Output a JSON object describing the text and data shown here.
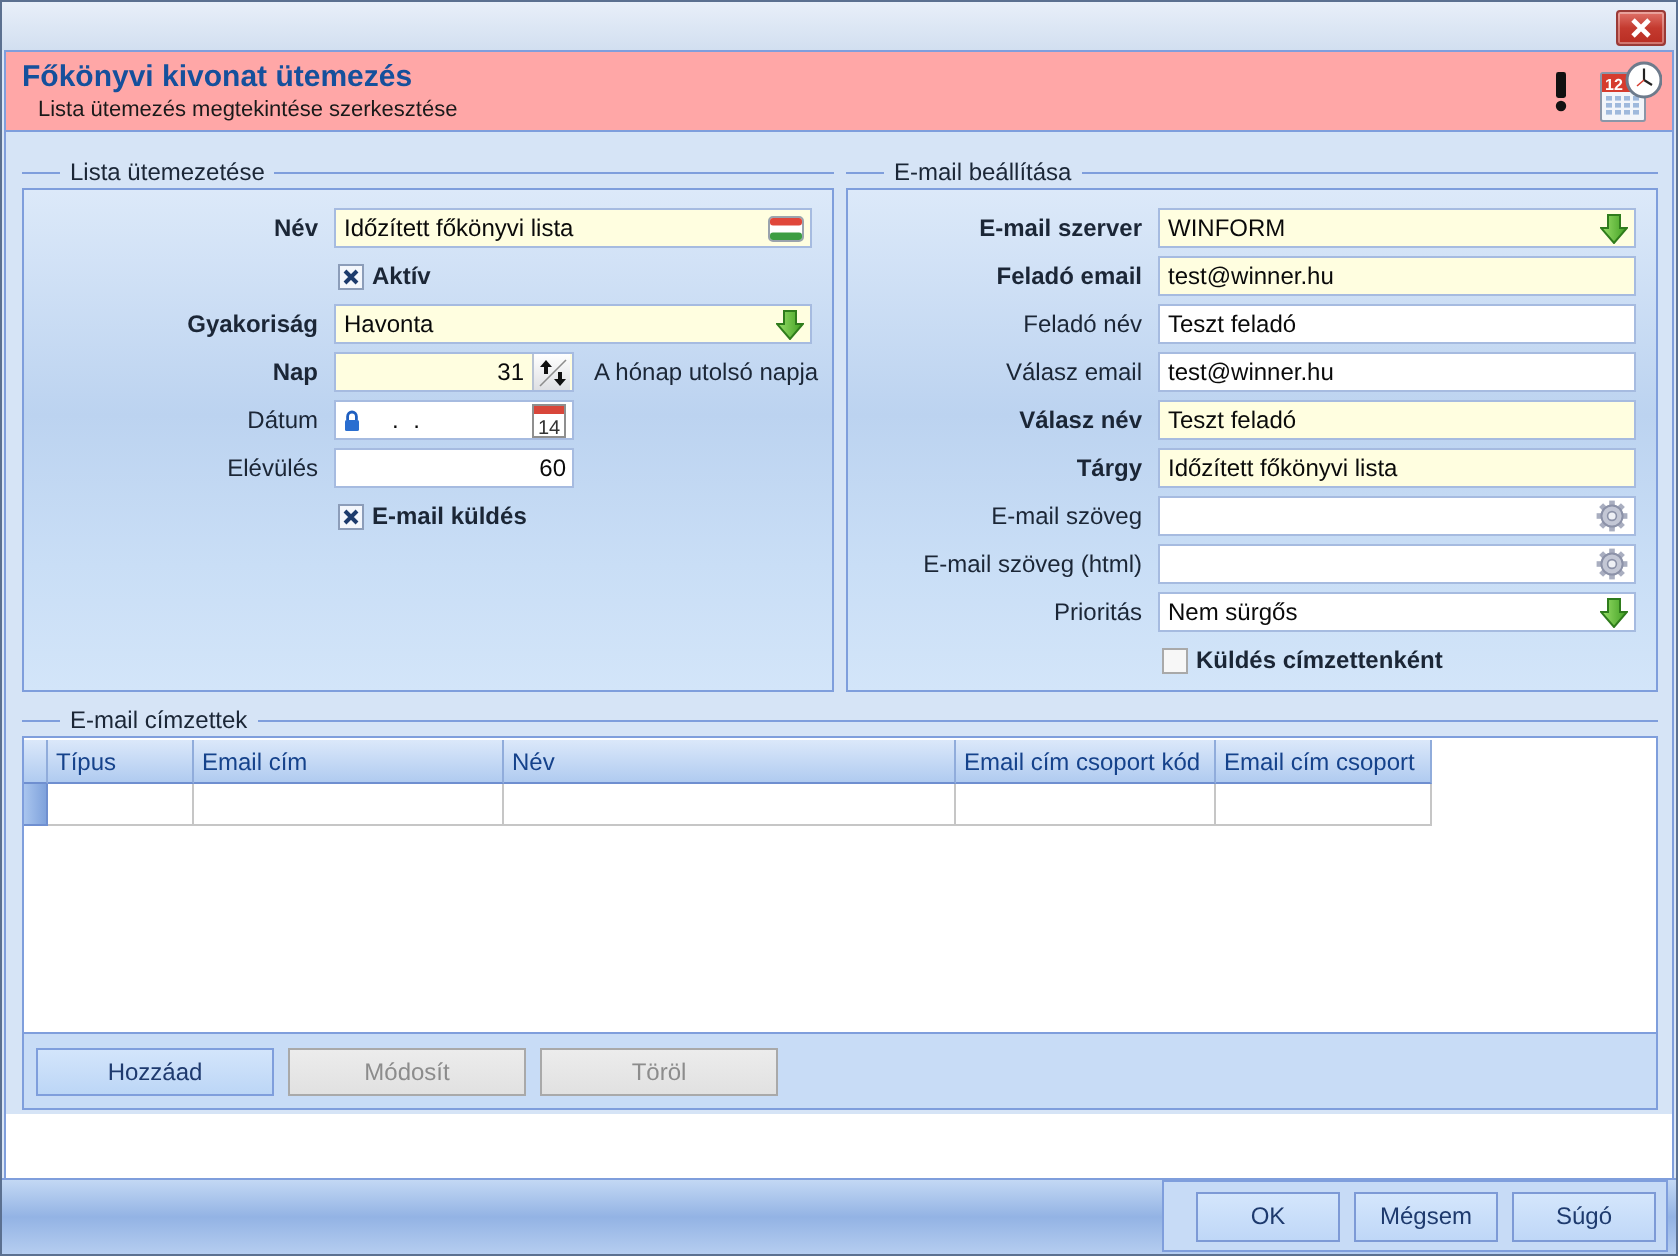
{
  "header": {
    "title": "Főkönyvi kivonat ütemezés",
    "subtitle": "Lista ütemezés megtekintése szerkesztése",
    "calendar_day": "12"
  },
  "schedule_group": {
    "title": "Lista ütemezetése",
    "rows": [
      {
        "kind": "localized",
        "label": "Név",
        "required": true,
        "value": "Időzített főkönyvi lista"
      },
      {
        "kind": "checkbox",
        "label": "Aktív",
        "checked": true
      },
      {
        "kind": "dropdown",
        "label": "Gyakoriság",
        "required": true,
        "value": "Havonta"
      },
      {
        "kind": "spinner",
        "label": "Nap",
        "required": true,
        "value": "31",
        "note": "A hónap utolsó napja"
      },
      {
        "kind": "date",
        "label": "Dátum",
        "required": false,
        "value": ". .",
        "picker_day": "14"
      },
      {
        "kind": "number",
        "label": "Elévülés",
        "required": false,
        "value": "60"
      },
      {
        "kind": "checkbox",
        "label": "E-mail küldés",
        "checked": true
      }
    ]
  },
  "email_group": {
    "title": "E-mail beállítása",
    "rows": [
      {
        "kind": "dropdown",
        "label": "E-mail szerver",
        "required": true,
        "value": "WINFORM"
      },
      {
        "kind": "text",
        "label": "Feladó email",
        "required": true,
        "value": "test@winner.hu"
      },
      {
        "kind": "text",
        "label": "Feladó név",
        "required": false,
        "value": "Teszt feladó"
      },
      {
        "kind": "text",
        "label": "Válasz email",
        "required": false,
        "value": "test@winner.hu"
      },
      {
        "kind": "text",
        "label": "Válasz név",
        "required": true,
        "value": "Teszt feladó"
      },
      {
        "kind": "text",
        "label": "Tárgy",
        "required": true,
        "value": "Időzített főkönyvi lista"
      },
      {
        "kind": "expression",
        "label": "E-mail szöveg",
        "required": false
      },
      {
        "kind": "expression",
        "label": "E-mail szöveg (html)",
        "required": false
      },
      {
        "kind": "dropdown",
        "label": "Prioritás",
        "required": false,
        "value": "Nem sürgős"
      },
      {
        "kind": "checkbox",
        "label": "Küldés címzettenként",
        "checked": false
      }
    ]
  },
  "recipients_group": {
    "title": "E-mail címzettek",
    "table": {
      "columns": [
        "Típus",
        "Email cím",
        "Név",
        "Email cím csoport kód",
        "Email cím csoport"
      ]
    },
    "buttons": [
      {
        "label": "Hozzáad",
        "disabled": false
      },
      {
        "label": "Módosít",
        "disabled": true
      },
      {
        "label": "Töröl",
        "disabled": true
      }
    ]
  },
  "footer": {
    "buttons": [
      {
        "label": "OK"
      },
      {
        "label": "Mégsem"
      },
      {
        "label": "Súgó"
      }
    ]
  }
}
